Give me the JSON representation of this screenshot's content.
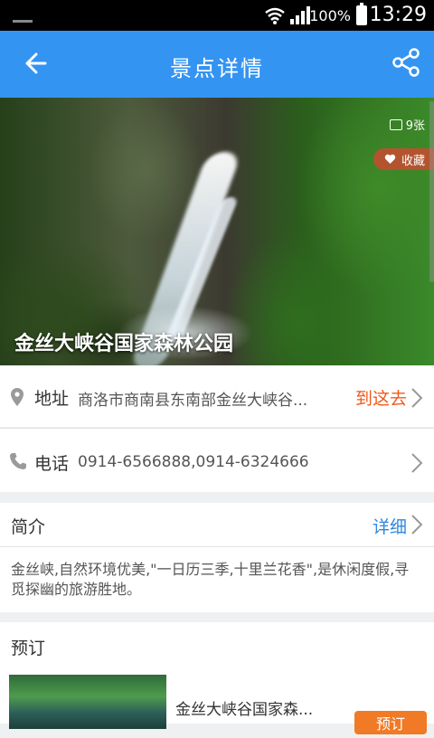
{
  "status_bar": {
    "time": "13:29",
    "battery": "100%"
  },
  "header": {
    "title": "景点详情",
    "back_icon": "arrow-left-icon",
    "share_icon": "share-icon",
    "background": "#3494f2"
  },
  "hero": {
    "photo_count": "9张",
    "favorite_label": "收藏",
    "attraction_name": "金丝大峡谷国家森林公园"
  },
  "info": {
    "address_label": "地址",
    "address_value": "商洛市商南县东南部金丝大峡谷...",
    "navigate_label": "到这去",
    "phone_label": "电话",
    "phone_value": "0914-6566888,0914-6324666"
  },
  "intro": {
    "title": "简介",
    "detail_label": "详细",
    "text": "金丝峡,自然环境优美,\"一日历三季,十里兰花香\",是休闲度假,寻觅探幽的旅游胜地。"
  },
  "booking": {
    "title": "预订",
    "product_name": "金丝大峡谷国家森...",
    "button_label": "预订"
  },
  "colors": {
    "accent": "#3494f2",
    "navigate": "#ef5a1a",
    "link": "#2f86e0",
    "button": "#f07a25",
    "favorite_badge": "#b3542f"
  }
}
